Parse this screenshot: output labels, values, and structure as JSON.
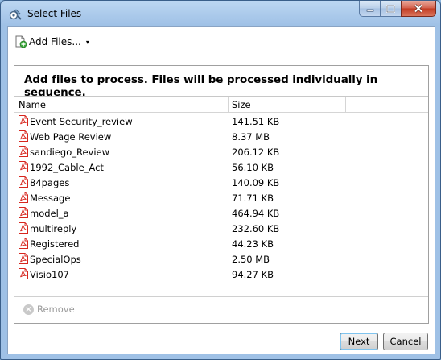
{
  "window": {
    "title": "Select Files"
  },
  "toolbar": {
    "add_files_label": "Add Files...",
    "add_files_caret": "▾"
  },
  "panel": {
    "heading": "Add files to process. Files will be processed individually in sequence.",
    "columns": {
      "name": "Name",
      "size": "Size"
    },
    "files": [
      {
        "name": "Event Security_review",
        "size": "141.51 KB"
      },
      {
        "name": "Web Page Review",
        "size": "8.37 MB"
      },
      {
        "name": "sandiego_Review",
        "size": "206.12 KB"
      },
      {
        "name": "1992_Cable_Act",
        "size": "56.10 KB"
      },
      {
        "name": "84pages",
        "size": "140.09 KB"
      },
      {
        "name": "Message",
        "size": "71.71 KB"
      },
      {
        "name": "model_a",
        "size": "464.94 KB"
      },
      {
        "name": "multireply",
        "size": "232.60 KB"
      },
      {
        "name": "Registered",
        "size": "44.23 KB"
      },
      {
        "name": "SpecialOps",
        "size": "2.50 MB"
      },
      {
        "name": "Visio107",
        "size": "94.27 KB"
      }
    ],
    "remove_label": "Remove"
  },
  "buttons": {
    "next": "Next",
    "cancel": "Cancel"
  },
  "icons": {
    "app": "wrench-gear-icon",
    "add_files": "add-file-icon",
    "file": "pdf-file-icon",
    "remove": "remove-icon"
  },
  "colors": {
    "pdf_red": "#d7261e",
    "title_bar": "#a9c8ea",
    "close_red": "#c23b22"
  }
}
